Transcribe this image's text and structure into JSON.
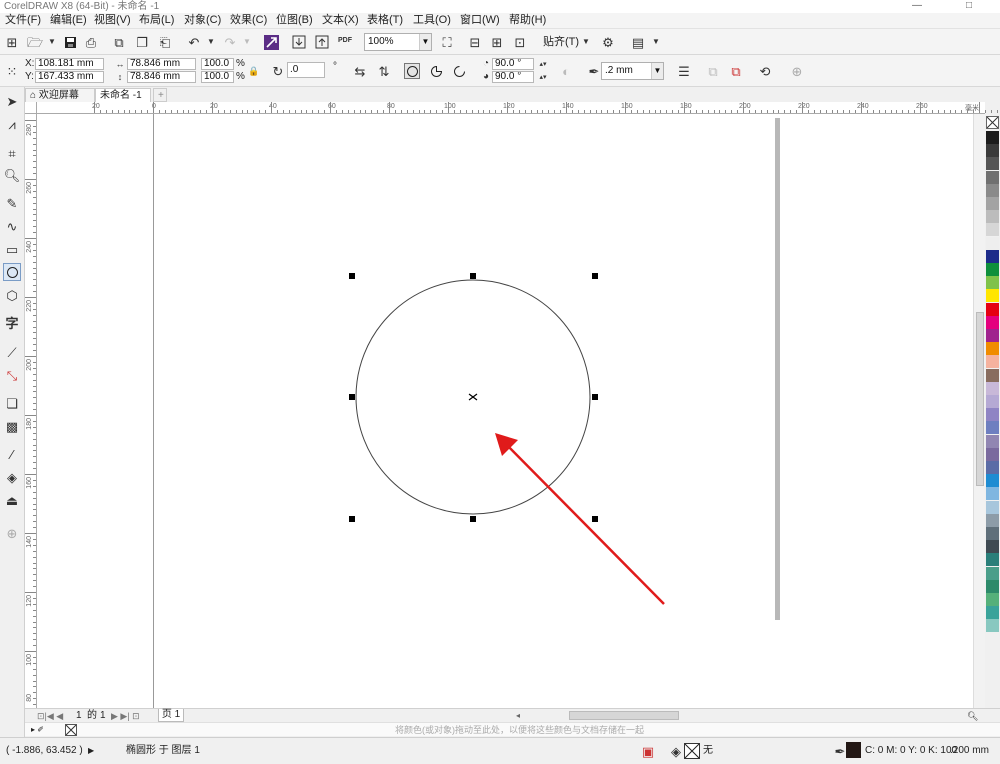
{
  "window": {
    "title": "CorelDRAW X8 (64-Bit) - 未命名 -1",
    "minimize": "—",
    "restore": "□"
  },
  "menu": [
    "文件(F)",
    "编辑(E)",
    "视图(V)",
    "布局(L)",
    "对象(C)",
    "效果(C)",
    "位图(B)",
    "文本(X)",
    "表格(T)",
    "工具(O)",
    "窗口(W)",
    "帮助(H)"
  ],
  "toolbar": {
    "zoom": "100%",
    "snap": "贴齐(T)",
    "pdf": "PDF"
  },
  "props": {
    "x": "108.181 mm",
    "y": "167.433 mm",
    "w": "78.846 mm",
    "h": "78.846 mm",
    "sx": "100.0",
    "sy": "100.0",
    "pct": "%",
    "xl": "X:",
    "yl": "Y:",
    "rotation": ".0",
    "deg": "°",
    "start_angle": "90.0 °",
    "end_angle": "90.0 °",
    "outline": ".2 mm"
  },
  "tabs": {
    "welcome": "欢迎屏幕",
    "doc": "未命名 -1",
    "add": "+"
  },
  "hruler": {
    "labels": [
      "20",
      "0",
      "20",
      "40",
      "60",
      "80",
      "100",
      "120",
      "140",
      "160",
      "180",
      "200",
      "220",
      "240",
      "260"
    ],
    "unit": "毫米"
  },
  "vruler": {
    "labels": [
      "280",
      "260",
      "240",
      "220",
      "200",
      "180",
      "160",
      "140",
      "120",
      "100",
      "80"
    ]
  },
  "pages": {
    "current": "1",
    "of": "的",
    "total": "1",
    "tab": "页 1"
  },
  "doc_hint": "将颜色(或对象)拖动至此处，以便将这些颜色与文档存储在一起",
  "status": {
    "coords": "( -1.886, 63.452 )",
    "object": "椭圆形 于 图层 1",
    "fill_none": "无",
    "color": "C: 0 M: 0 Y: 0 K: 100",
    "width": ".200 mm"
  },
  "palette": [
    "#1c1c1c",
    "#3a3a3a",
    "#555555",
    "#707070",
    "#8a8a8a",
    "#a3a3a3",
    "#bcbcbc",
    "#d6d6d6",
    "#eeeeee",
    "#1d2b8a",
    "#0e8f3c",
    "#7fc24a",
    "#ffe600",
    "#e50012",
    "#e4007e",
    "#a0238e",
    "#f08c00",
    "#f5b29e",
    "#886c5e",
    "#c8b8d8",
    "#b5a9d4",
    "#8f84c4",
    "#6e7fc0",
    "#9186b2",
    "#7a6a9e",
    "#5b6ca6",
    "#1e8cd2",
    "#7fb6e0",
    "#a7c6dc",
    "#8d9ca8",
    "#5f6f7a",
    "#3f4a52",
    "#2a7f7a",
    "#4a9e8a",
    "#2d8a6a",
    "#55b07a",
    "#3aa39a",
    "#88c8c0"
  ]
}
